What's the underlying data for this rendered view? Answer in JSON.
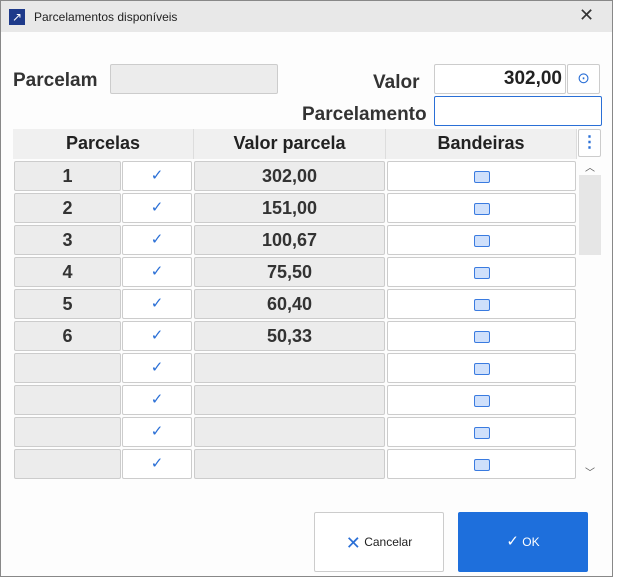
{
  "window": {
    "title": "Parcelamentos disponíveis"
  },
  "form": {
    "parcelam_label": "Parcelam",
    "valor_label": "Valor",
    "valor_value": "302,00",
    "parcelamento_label": "Parcelamento",
    "parcelamento_value": ""
  },
  "grid": {
    "headers": [
      "Parcelas",
      "Valor parcela",
      "Bandeiras"
    ],
    "rows": [
      {
        "parcela": "1",
        "valor": "302,00"
      },
      {
        "parcela": "2",
        "valor": "151,00"
      },
      {
        "parcela": "3",
        "valor": "100,67"
      },
      {
        "parcela": "4",
        "valor": "75,50"
      },
      {
        "parcela": "5",
        "valor": "60,40"
      },
      {
        "parcela": "6",
        "valor": "50,33"
      },
      {
        "parcela": "",
        "valor": ""
      },
      {
        "parcela": "",
        "valor": ""
      },
      {
        "parcela": "",
        "valor": ""
      },
      {
        "parcela": "",
        "valor": ""
      }
    ]
  },
  "buttons": {
    "cancel": "Cancelar",
    "ok": "OK"
  },
  "colors": {
    "accent": "#1e6fdc"
  }
}
